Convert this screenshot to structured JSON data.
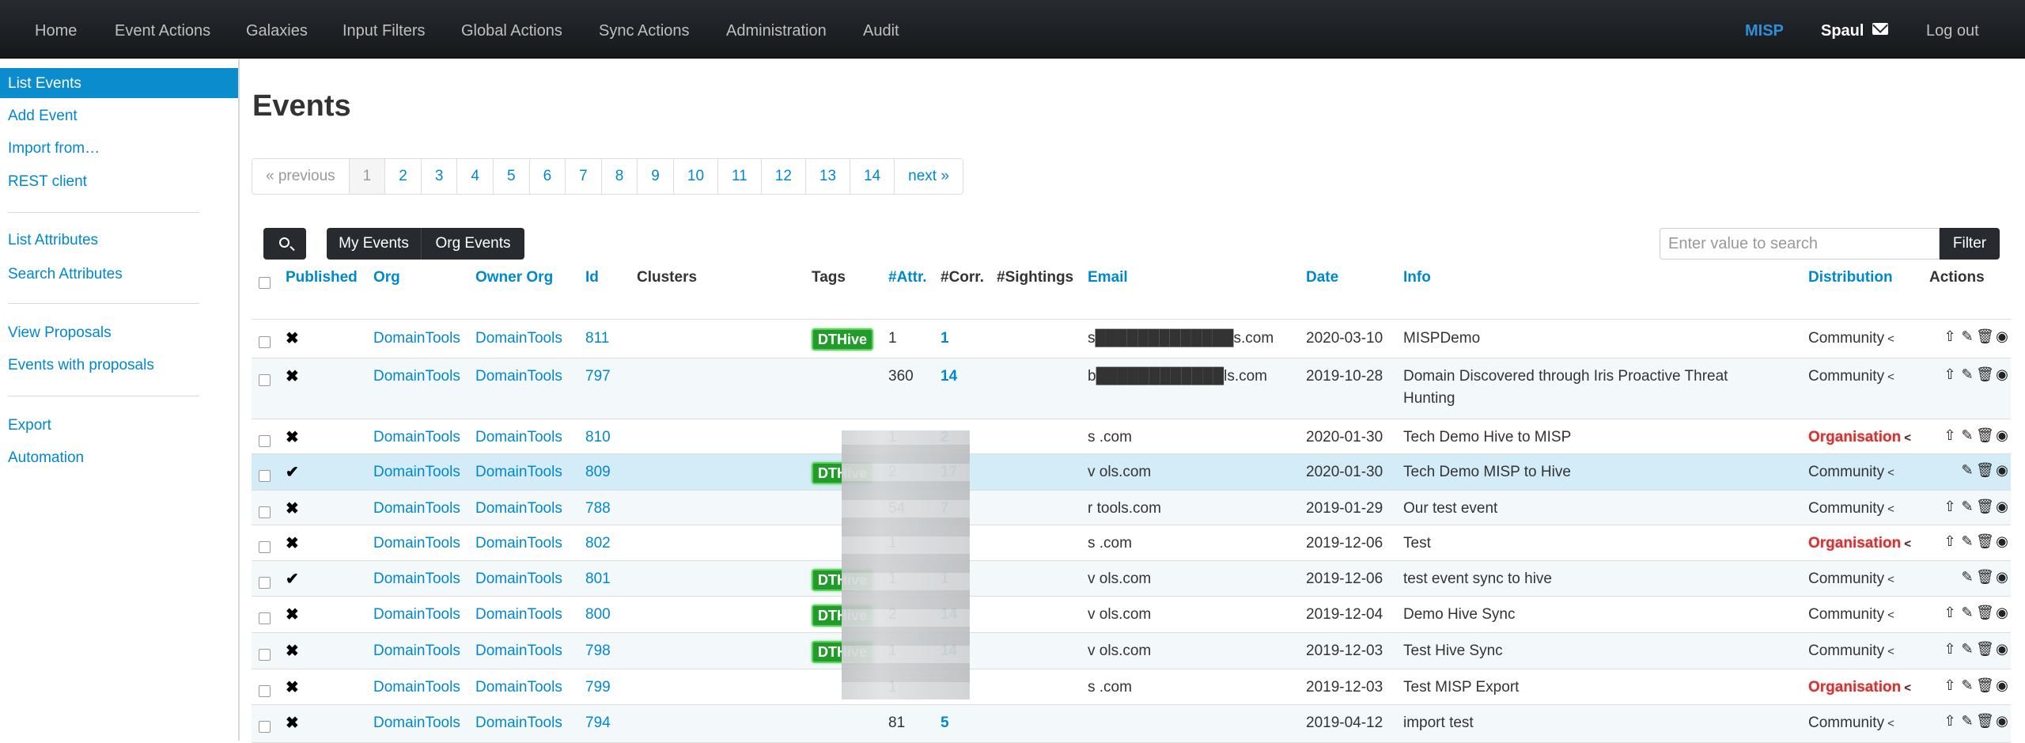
{
  "nav": {
    "items": [
      "Home",
      "Event Actions",
      "Galaxies",
      "Input Filters",
      "Global Actions",
      "Sync Actions",
      "Administration",
      "Audit"
    ],
    "brand": "MISP",
    "user": "Spaul",
    "logout": "Log out"
  },
  "sidebar": {
    "items": [
      "List Events",
      "Add Event",
      "Import from…",
      "REST client",
      "List Attributes",
      "Search Attributes",
      "View Proposals",
      "Events with proposals",
      "Export",
      "Automation"
    ]
  },
  "main": {
    "title": "Events",
    "pagination": [
      "« previous",
      "1",
      "2",
      "3",
      "4",
      "5",
      "6",
      "7",
      "8",
      "9",
      "10",
      "11",
      "12",
      "13",
      "14",
      "next »"
    ],
    "my_events": "My Events",
    "org_events": "Org Events",
    "search_placeholder": "Enter value to search",
    "filter": "Filter"
  },
  "table": {
    "headers": {
      "published": "Published",
      "org": "Org",
      "owner_org": "Owner Org",
      "id": "Id",
      "clusters": "Clusters",
      "tags": "Tags",
      "attr": "#Attr.",
      "corr": "#Corr.",
      "sightings": "#Sightings",
      "email": "Email",
      "date": "Date",
      "info": "Info",
      "distribution": "Distribution",
      "actions": "Actions"
    },
    "rows": [
      {
        "pub": "✖",
        "org": "DomainTools",
        "owner": "DomainTools",
        "id": "811",
        "tag": "DTHive",
        "attr": "1",
        "corr": "1",
        "email": "s█████████████s.com",
        "date": "2020-03-10",
        "info": "MISPDemo",
        "info2": "",
        "dist": "Community",
        "dist_type": "comm",
        "publish_icon": true
      },
      {
        "pub": "✖",
        "org": "DomainTools",
        "owner": "DomainTools",
        "id": "797",
        "tag": "",
        "attr": "360",
        "corr": "14",
        "email": "b████████████ls.com",
        "date": "2019-10-28",
        "info": "Domain Discovered through Iris Proactive Threat",
        "info2": "Hunting",
        "dist": "Community",
        "dist_type": "comm",
        "publish_icon": true
      },
      {
        "pub": "✖",
        "org": "DomainTools",
        "owner": "DomainTools",
        "id": "810",
        "tag": "",
        "attr": "1",
        "corr": "2",
        "email": "s                          .com",
        "date": "2020-01-30",
        "info": "Tech Demo Hive to MISP",
        "info2": "",
        "dist": "Organisation",
        "dist_type": "org",
        "publish_icon": true
      },
      {
        "pub": "✔",
        "org": "DomainTools",
        "owner": "DomainTools",
        "id": "809",
        "tag": "DTHive",
        "attr": "2",
        "corr": "17",
        "email": "v                          ols.com",
        "date": "2020-01-30",
        "info": "Tech Demo MISP to Hive",
        "info2": "",
        "dist": "Community",
        "dist_type": "comm",
        "publish_icon": false
      },
      {
        "pub": "✖",
        "org": "DomainTools",
        "owner": "DomainTools",
        "id": "788",
        "tag": "",
        "attr": "54",
        "corr": "7",
        "email": "r                          tools.com",
        "date": "2019-01-29",
        "info": "Our test event",
        "info2": "",
        "dist": "Community",
        "dist_type": "comm",
        "publish_icon": true
      },
      {
        "pub": "✖",
        "org": "DomainTools",
        "owner": "DomainTools",
        "id": "802",
        "tag": "",
        "attr": "1",
        "corr": "",
        "email": "s                          .com",
        "date": "2019-12-06",
        "info": "Test",
        "info2": "",
        "dist": "Organisation",
        "dist_type": "org",
        "publish_icon": true
      },
      {
        "pub": "✔",
        "org": "DomainTools",
        "owner": "DomainTools",
        "id": "801",
        "tag": "DTHive",
        "attr": "1",
        "corr": "1",
        "email": "v                          ols.com",
        "date": "2019-12-06",
        "info": "test event sync to hive",
        "info2": "",
        "dist": "Community",
        "dist_type": "comm",
        "publish_icon": false
      },
      {
        "pub": "✖",
        "org": "DomainTools",
        "owner": "DomainTools",
        "id": "800",
        "tag": "DTHive",
        "attr": "2",
        "corr": "14",
        "email": "v                          ols.com",
        "date": "2019-12-04",
        "info": "Demo Hive Sync",
        "info2": "",
        "dist": "Community",
        "dist_type": "comm",
        "publish_icon": true
      },
      {
        "pub": "✖",
        "org": "DomainTools",
        "owner": "DomainTools",
        "id": "798",
        "tag": "DTHive",
        "attr": "1",
        "corr": "14",
        "email": "v                          ols.com",
        "date": "2019-12-03",
        "info": "Test Hive Sync",
        "info2": "",
        "dist": "Community",
        "dist_type": "comm",
        "publish_icon": true
      },
      {
        "pub": "✖",
        "org": "DomainTools",
        "owner": "DomainTools",
        "id": "799",
        "tag": "",
        "attr": "1",
        "corr": "",
        "email": "s                          .com",
        "date": "2019-12-03",
        "info": "Test MISP Export",
        "info2": "",
        "dist": "Organisation",
        "dist_type": "org",
        "publish_icon": true
      },
      {
        "pub": "✖",
        "org": "DomainTools",
        "owner": "DomainTools",
        "id": "794",
        "tag": "",
        "attr": "81",
        "corr": "5",
        "email": "",
        "date": "2019-04-12",
        "info": "import test",
        "info2": "",
        "dist": "Community",
        "dist_type": "comm",
        "publish_icon": true
      }
    ]
  },
  "icons": {
    "publish": "upload-icon",
    "edit": "edit-icon",
    "delete": "trash-icon",
    "view": "eye-icon",
    "share": "share-icon"
  }
}
